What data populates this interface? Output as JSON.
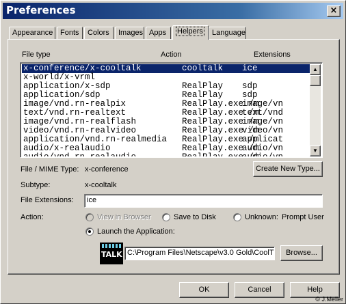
{
  "window": {
    "title": "Preferences",
    "close_glyph": "×"
  },
  "tabs": [
    {
      "label": "Appearance"
    },
    {
      "label": "Fonts"
    },
    {
      "label": "Colors"
    },
    {
      "label": "Images"
    },
    {
      "label": "Apps"
    },
    {
      "label": "Helpers",
      "active": true
    },
    {
      "label": "Language"
    }
  ],
  "helpers": {
    "columns": {
      "file_type": "File type",
      "action": "Action",
      "extensions": "Extensions"
    },
    "rows": [
      {
        "type": "x-conference/x-cooltalk",
        "action": "cooltalk",
        "ext": "ice",
        "selected": true
      },
      {
        "type": "x-world/x-vrml",
        "action": "",
        "ext": ""
      },
      {
        "type": "application/x-sdp",
        "action": "RealPlay",
        "ext": "sdp"
      },
      {
        "type": "application/sdp",
        "action": "RealPlay",
        "ext": "sdp"
      },
      {
        "type": "image/vnd.rn-realpix",
        "action": "RealPlay.exe /m",
        "ext": "image/vn"
      },
      {
        "type": "text/vnd.rn-realtext",
        "action": "RealPlay.exe /m",
        "ext": "text/vnd"
      },
      {
        "type": "image/vnd.rn-realflash",
        "action": "RealPlay.exe /m",
        "ext": "image/vn"
      },
      {
        "type": "video/vnd.rn-realvideo",
        "action": "RealPlay.exe /m",
        "ext": "video/vn"
      },
      {
        "type": "application/vnd.rn-realmedia",
        "action": "RealPlay.exe /m",
        "ext": "applicat"
      },
      {
        "type": "audio/x-realaudio",
        "action": "RealPlay.exe /m",
        "ext": "audio/vn"
      },
      {
        "type": "audio/vnd.rn-realaudio",
        "action": "RealPlay.exe /m",
        "ext": "audio/vn"
      }
    ],
    "scroll_up_glyph": "▲",
    "scroll_down_glyph": "▼",
    "mime_label": "File / MIME Type:",
    "mime_value": "x-conference",
    "subtype_label": "Subtype:",
    "subtype_value": "x-cooltalk",
    "create_button": "Create New Type...",
    "ext_label": "File Extensions:",
    "ext_value": "ice",
    "action_label": "Action:",
    "options": {
      "view_in_browser": "View in Browser",
      "save_to_disk": "Save to Disk",
      "unknown": "Unknown:",
      "prompt_user": "Prompt User",
      "launch": "Launch the Application:"
    },
    "selected_action": "launch",
    "app_icon_text": "TALK",
    "app_path": "C:\\Program Files\\Netscape\\v3.0 Gold\\CoolT",
    "browse_button": "Browse..."
  },
  "footer": {
    "ok": "OK",
    "cancel": "Cancel",
    "help": "Help"
  },
  "watermark": "© J.Meller",
  "colors": {
    "titlebar_start": "#0a246a",
    "titlebar_end": "#a6caf0",
    "selection": "#0a246a",
    "face": "#d4d0c8"
  }
}
